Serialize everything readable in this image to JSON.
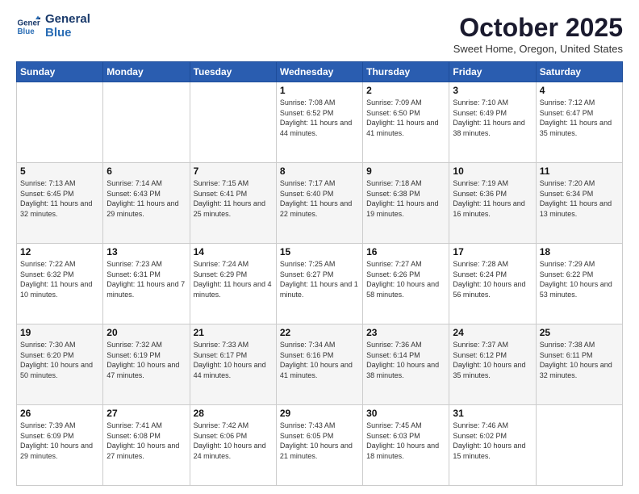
{
  "header": {
    "logo_line1": "General",
    "logo_line2": "Blue",
    "month": "October 2025",
    "location": "Sweet Home, Oregon, United States"
  },
  "days_of_week": [
    "Sunday",
    "Monday",
    "Tuesday",
    "Wednesday",
    "Thursday",
    "Friday",
    "Saturday"
  ],
  "weeks": [
    [
      {
        "day": "",
        "info": ""
      },
      {
        "day": "",
        "info": ""
      },
      {
        "day": "",
        "info": ""
      },
      {
        "day": "1",
        "info": "Sunrise: 7:08 AM\nSunset: 6:52 PM\nDaylight: 11 hours and 44 minutes."
      },
      {
        "day": "2",
        "info": "Sunrise: 7:09 AM\nSunset: 6:50 PM\nDaylight: 11 hours and 41 minutes."
      },
      {
        "day": "3",
        "info": "Sunrise: 7:10 AM\nSunset: 6:49 PM\nDaylight: 11 hours and 38 minutes."
      },
      {
        "day": "4",
        "info": "Sunrise: 7:12 AM\nSunset: 6:47 PM\nDaylight: 11 hours and 35 minutes."
      }
    ],
    [
      {
        "day": "5",
        "info": "Sunrise: 7:13 AM\nSunset: 6:45 PM\nDaylight: 11 hours and 32 minutes."
      },
      {
        "day": "6",
        "info": "Sunrise: 7:14 AM\nSunset: 6:43 PM\nDaylight: 11 hours and 29 minutes."
      },
      {
        "day": "7",
        "info": "Sunrise: 7:15 AM\nSunset: 6:41 PM\nDaylight: 11 hours and 25 minutes."
      },
      {
        "day": "8",
        "info": "Sunrise: 7:17 AM\nSunset: 6:40 PM\nDaylight: 11 hours and 22 minutes."
      },
      {
        "day": "9",
        "info": "Sunrise: 7:18 AM\nSunset: 6:38 PM\nDaylight: 11 hours and 19 minutes."
      },
      {
        "day": "10",
        "info": "Sunrise: 7:19 AM\nSunset: 6:36 PM\nDaylight: 11 hours and 16 minutes."
      },
      {
        "day": "11",
        "info": "Sunrise: 7:20 AM\nSunset: 6:34 PM\nDaylight: 11 hours and 13 minutes."
      }
    ],
    [
      {
        "day": "12",
        "info": "Sunrise: 7:22 AM\nSunset: 6:32 PM\nDaylight: 11 hours and 10 minutes."
      },
      {
        "day": "13",
        "info": "Sunrise: 7:23 AM\nSunset: 6:31 PM\nDaylight: 11 hours and 7 minutes."
      },
      {
        "day": "14",
        "info": "Sunrise: 7:24 AM\nSunset: 6:29 PM\nDaylight: 11 hours and 4 minutes."
      },
      {
        "day": "15",
        "info": "Sunrise: 7:25 AM\nSunset: 6:27 PM\nDaylight: 11 hours and 1 minute."
      },
      {
        "day": "16",
        "info": "Sunrise: 7:27 AM\nSunset: 6:26 PM\nDaylight: 10 hours and 58 minutes."
      },
      {
        "day": "17",
        "info": "Sunrise: 7:28 AM\nSunset: 6:24 PM\nDaylight: 10 hours and 56 minutes."
      },
      {
        "day": "18",
        "info": "Sunrise: 7:29 AM\nSunset: 6:22 PM\nDaylight: 10 hours and 53 minutes."
      }
    ],
    [
      {
        "day": "19",
        "info": "Sunrise: 7:30 AM\nSunset: 6:20 PM\nDaylight: 10 hours and 50 minutes."
      },
      {
        "day": "20",
        "info": "Sunrise: 7:32 AM\nSunset: 6:19 PM\nDaylight: 10 hours and 47 minutes."
      },
      {
        "day": "21",
        "info": "Sunrise: 7:33 AM\nSunset: 6:17 PM\nDaylight: 10 hours and 44 minutes."
      },
      {
        "day": "22",
        "info": "Sunrise: 7:34 AM\nSunset: 6:16 PM\nDaylight: 10 hours and 41 minutes."
      },
      {
        "day": "23",
        "info": "Sunrise: 7:36 AM\nSunset: 6:14 PM\nDaylight: 10 hours and 38 minutes."
      },
      {
        "day": "24",
        "info": "Sunrise: 7:37 AM\nSunset: 6:12 PM\nDaylight: 10 hours and 35 minutes."
      },
      {
        "day": "25",
        "info": "Sunrise: 7:38 AM\nSunset: 6:11 PM\nDaylight: 10 hours and 32 minutes."
      }
    ],
    [
      {
        "day": "26",
        "info": "Sunrise: 7:39 AM\nSunset: 6:09 PM\nDaylight: 10 hours and 29 minutes."
      },
      {
        "day": "27",
        "info": "Sunrise: 7:41 AM\nSunset: 6:08 PM\nDaylight: 10 hours and 27 minutes."
      },
      {
        "day": "28",
        "info": "Sunrise: 7:42 AM\nSunset: 6:06 PM\nDaylight: 10 hours and 24 minutes."
      },
      {
        "day": "29",
        "info": "Sunrise: 7:43 AM\nSunset: 6:05 PM\nDaylight: 10 hours and 21 minutes."
      },
      {
        "day": "30",
        "info": "Sunrise: 7:45 AM\nSunset: 6:03 PM\nDaylight: 10 hours and 18 minutes."
      },
      {
        "day": "31",
        "info": "Sunrise: 7:46 AM\nSunset: 6:02 PM\nDaylight: 10 hours and 15 minutes."
      },
      {
        "day": "",
        "info": ""
      }
    ]
  ]
}
